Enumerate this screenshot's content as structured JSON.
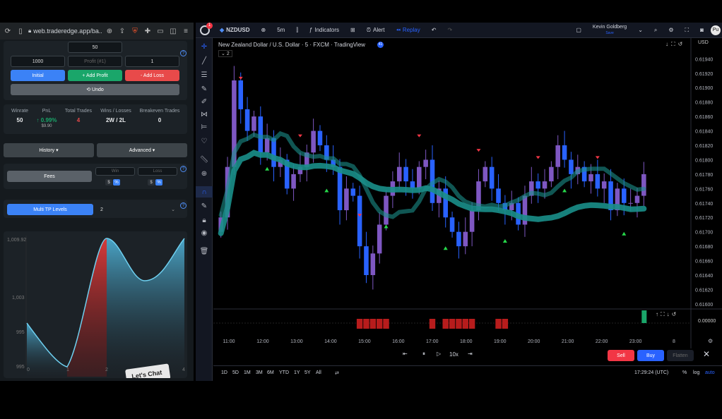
{
  "browser": {
    "url": "web.traderedge.app/ba..."
  },
  "left": {
    "top_input": "50",
    "inputs": [
      {
        "value": "1000"
      },
      {
        "placeholder": "Profit (#1)"
      },
      {
        "value": "1"
      }
    ],
    "buttons": {
      "initial": "Initial",
      "add_profit": "+ Add Profit",
      "add_loss": "- Add Loss",
      "undo": "⟲ Undo"
    },
    "stats": [
      {
        "label": "Winrate",
        "value": "50"
      },
      {
        "label": "PnL",
        "value": "↑ 0.99%",
        "sub": "$9.90"
      },
      {
        "label": "Total Trades",
        "value": "4"
      },
      {
        "label": "Wins / Losses",
        "value": "2W / 2L"
      },
      {
        "label": "Breakeven Trades",
        "value": "0"
      }
    ],
    "history": "History ▾",
    "advanced": "Advanced ▾",
    "fees": "Fees",
    "win_ph": "Win",
    "loss_ph": "Loss",
    "toggle_dollar": "$",
    "toggle_pct": "%",
    "multi_tp": "Multi TP Levels",
    "multi_tp_value": "2",
    "curve": {
      "ylabels": [
        "1,009.92",
        "1,003",
        "995",
        "995"
      ],
      "xlabels": [
        "0",
        "1",
        "2",
        "3",
        "4"
      ],
      "tag": "Let's Chat"
    }
  },
  "topbar": {
    "symbol": "NZDUSD",
    "interval": "5m",
    "indicators": "Indicators",
    "alert": "Alert",
    "replay": "Replay",
    "user": "Kevin Goldberg",
    "user_sub": "Save"
  },
  "chart": {
    "title": "New Zealand Dollar / U.S. Dollar · 5 · FXCM · TradingView",
    "legend_count": "2",
    "currency": "USD",
    "price_labels": [
      "0.61940",
      "0.61920",
      "0.61900",
      "0.61880",
      "0.61860",
      "0.61840",
      "0.61820",
      "0.61800",
      "0.61780",
      "0.61760",
      "0.61740",
      "0.61720",
      "0.61700",
      "0.61680",
      "0.61660",
      "0.61640",
      "0.61620",
      "0.61600"
    ],
    "osc_label": "0.00000",
    "time_labels": [
      "11:00",
      "12:00",
      "13:00",
      "14:00",
      "15:00",
      "16:00",
      "17:00",
      "18:00",
      "19:00",
      "20:00",
      "21:00",
      "22:00",
      "23:00",
      "8"
    ]
  },
  "chart_data": {
    "type": "candlestick",
    "xlabel": "",
    "ylabel": "",
    "ylim": [
      0.61595,
      0.61955
    ],
    "x_ticks": [
      "11:00",
      "12:00",
      "13:00",
      "14:00",
      "15:00",
      "16:00",
      "17:00",
      "18:00",
      "19:00",
      "20:00",
      "21:00",
      "22:00",
      "23:00"
    ],
    "close": [
      0.6172,
      0.6179,
      0.6191,
      0.6187,
      0.6184,
      0.6186,
      0.6181,
      0.6183,
      0.6179,
      0.618,
      0.6176,
      0.6178,
      0.6179,
      0.6181,
      0.6184,
      0.6182,
      0.618,
      0.6179,
      0.6173,
      0.6176,
      0.6175,
      0.6168,
      0.6164,
      0.6167,
      0.6171,
      0.6175,
      0.6177,
      0.6179,
      0.6177,
      0.6176,
      0.6179,
      0.618,
      0.6174,
      0.6176,
      0.6172,
      0.617,
      0.6168,
      0.617,
      0.6173,
      0.6177,
      0.6179,
      0.6176,
      0.6174,
      0.6173,
      0.6174,
      0.6171,
      0.6175,
      0.6177,
      0.6176,
      0.6177,
      0.6179,
      0.6182,
      0.618,
      0.6178,
      0.6179,
      0.6177,
      0.6178,
      0.6176,
      0.6177,
      0.6173,
      0.6176,
      0.6174,
      0.6174,
      0.6175,
      0.6178
    ]
  },
  "replay": {
    "speed": "10x",
    "sell": "Sell",
    "buy": "Buy",
    "flatten": "Flatten"
  },
  "bottom": {
    "timeframes": [
      "1D",
      "5D",
      "1M",
      "3M",
      "6M",
      "YTD",
      "1Y",
      "5Y",
      "All"
    ],
    "clock": "17:29:24 (UTC)",
    "pct": "%",
    "log": "log",
    "auto": "auto"
  },
  "colors": {
    "accent": "#2962ff",
    "bull": "#7e57c2",
    "bear": "#2962ff",
    "buy": "#2962ff",
    "sell": "#f23645",
    "profit": "#1aa66a",
    "loss": "#e84a4a",
    "cloud": "#1a8f8a"
  }
}
